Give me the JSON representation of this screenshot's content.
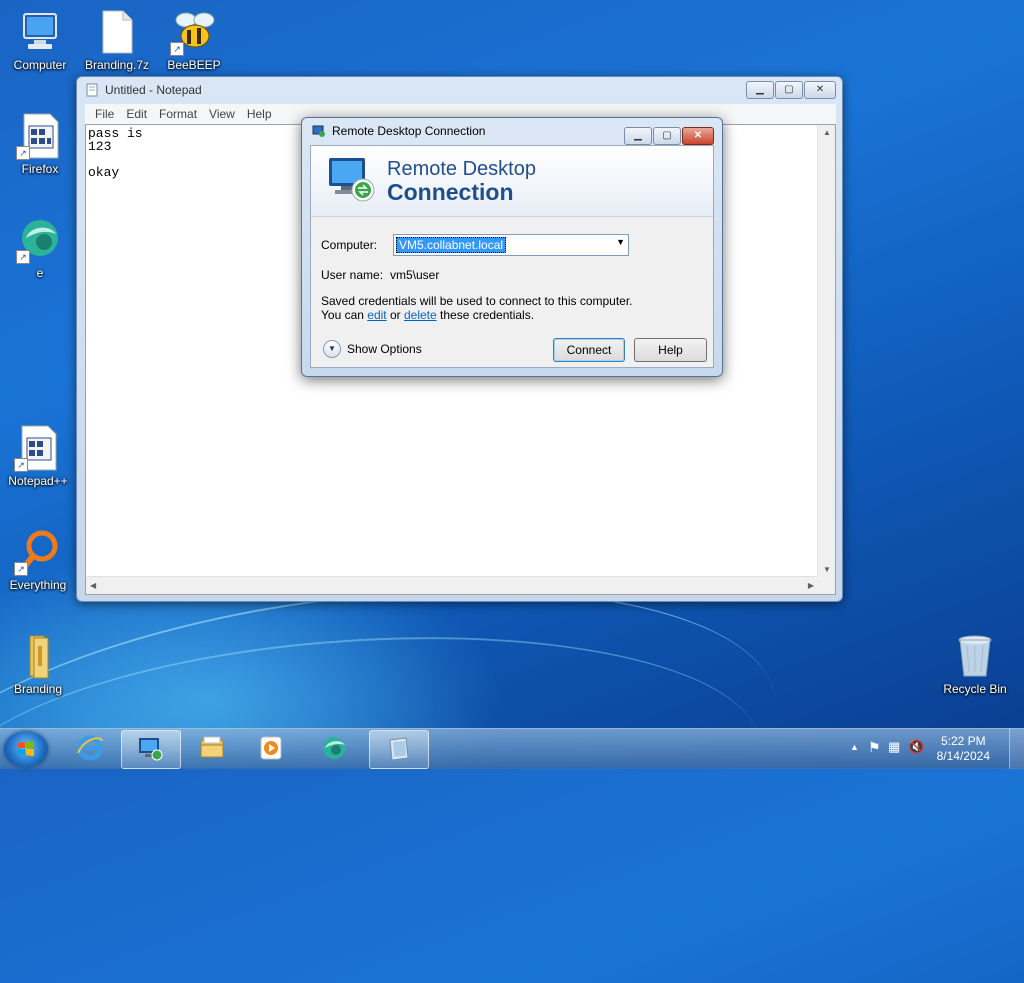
{
  "desktop": {
    "icons": [
      {
        "label": "Computer",
        "icon": "computer-icon"
      },
      {
        "label": "Branding.7z",
        "icon": "archive-file-icon"
      },
      {
        "label": "BeeBEEP",
        "icon": "bee-icon"
      },
      {
        "label": "Firefox",
        "icon": "firefox-shortcut-icon"
      },
      {
        "label": "e",
        "icon": "e-globe-icon"
      },
      {
        "label": "Notepad++",
        "icon": "notepad-plus-icon"
      },
      {
        "label": "Everything",
        "icon": "magnifier-icon"
      },
      {
        "label": "Branding",
        "icon": "folder-icon"
      },
      {
        "label": "Recycle Bin",
        "icon": "recycle-bin-icon"
      }
    ]
  },
  "notepad": {
    "title": "Untitled - Notepad",
    "menu": [
      "File",
      "Edit",
      "Format",
      "View",
      "Help"
    ],
    "content": "pass is\n123\n\nokay"
  },
  "rdp": {
    "title": "Remote Desktop Connection",
    "banner_line1": "Remote Desktop",
    "banner_line2": "Connection",
    "computer_label": "Computer:",
    "computer_value": "VM5.collabnet.local",
    "username_label": "User name:",
    "username_value": "vm5\\user",
    "info_line1": "Saved credentials will be used to connect to this computer.",
    "info_prefix": "You can ",
    "edit_link": "edit",
    "info_middle": " or ",
    "delete_link": "delete",
    "info_suffix": " these credentials.",
    "show_options": "Show Options",
    "connect": "Connect",
    "help": "Help"
  },
  "taskbar": {
    "items": [
      "internet-explorer-icon",
      "remote-desktop-icon",
      "file-explorer-icon",
      "media-player-icon",
      "e-globe-icon",
      "notepad-icon"
    ],
    "time": "5:22 PM",
    "date": "8/14/2024"
  },
  "colors": {
    "accent": "#1f4e8c",
    "selection": "#3399ff",
    "link": "#0066cc"
  }
}
